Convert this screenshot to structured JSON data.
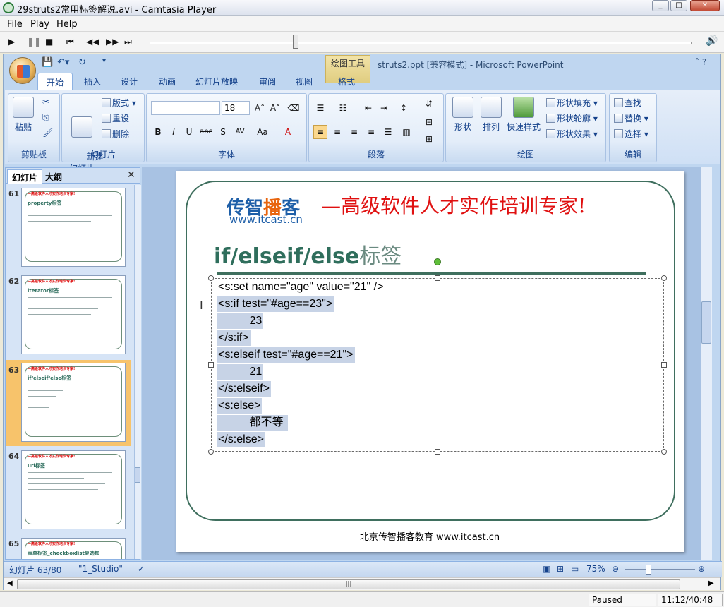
{
  "window": {
    "title": "29struts2常用标签解说.avi - Camtasia Player",
    "controls": [
      "_",
      "□",
      "✕"
    ]
  },
  "menu": [
    "File",
    "Play",
    "Help"
  ],
  "player": {
    "status": "Paused",
    "time": "11:12/40:48",
    "progress": 0.27
  },
  "ppt": {
    "doc_title": "struts2.ppt [兼容模式] - Microsoft PowerPoint",
    "context_tab_group": "绘图工具",
    "tabs": [
      "开始",
      "插入",
      "设计",
      "动画",
      "幻灯片放映",
      "审阅",
      "视图",
      "格式"
    ],
    "active_tab": "开始",
    "ribbon": {
      "clipboard": {
        "label": "剪贴板",
        "paste": "粘贴"
      },
      "slides": {
        "label": "幻灯片",
        "new_slide": "新建\n幻灯片",
        "layout": "版式",
        "reset": "重设",
        "delete": "删除"
      },
      "font": {
        "label": "字体",
        "font_name": "",
        "font_size": "18"
      },
      "paragraph": {
        "label": "段落"
      },
      "drawing": {
        "label": "绘图",
        "shapes": "形状",
        "arrange": "排列",
        "quick_styles": "快速样式",
        "fill": "形状填充",
        "outline": "形状轮廓",
        "effects": "形状效果"
      },
      "editing": {
        "label": "编辑",
        "find": "查找",
        "replace": "替换",
        "select": "选择"
      }
    },
    "left_pane": {
      "tabs": [
        "幻灯片",
        "大纲"
      ],
      "thumbnails": [
        {
          "num": "61",
          "title": "property标签"
        },
        {
          "num": "62",
          "title": "iterator标签"
        },
        {
          "num": "63",
          "title": "if/elseif/else标签",
          "selected": true
        },
        {
          "num": "64",
          "title": "url标签"
        },
        {
          "num": "65",
          "title": "表单标签_checkboxlist复选框"
        }
      ],
      "thumb_header": "—高级软件人才实作培训专家!"
    },
    "slide": {
      "logo_cn_part1": "传智",
      "logo_cn_hot": "播",
      "logo_cn_part2": "客",
      "logo_url": "www.itcast.cn",
      "slogan": "—高级软件人才实作培训专家!",
      "heading_bold": "if/elseif/else",
      "heading_light": "标签",
      "code_lines": [
        "<s:set name=\"age\" value=\"21\" />",
        "<s:if test=\"#age==23\">",
        "          23",
        "</s:if>",
        "<s:elseif test=\"#age==21\">",
        "          21",
        "</s:elseif>",
        "<s:else>",
        "          都不等 ",
        "</s:else>"
      ],
      "footer": "北京传智播客教育 www.itcast.cn"
    },
    "status": {
      "slide_info": "幻灯片 63/80",
      "theme": "\"1_Studio\"",
      "zoom": "75%"
    }
  }
}
